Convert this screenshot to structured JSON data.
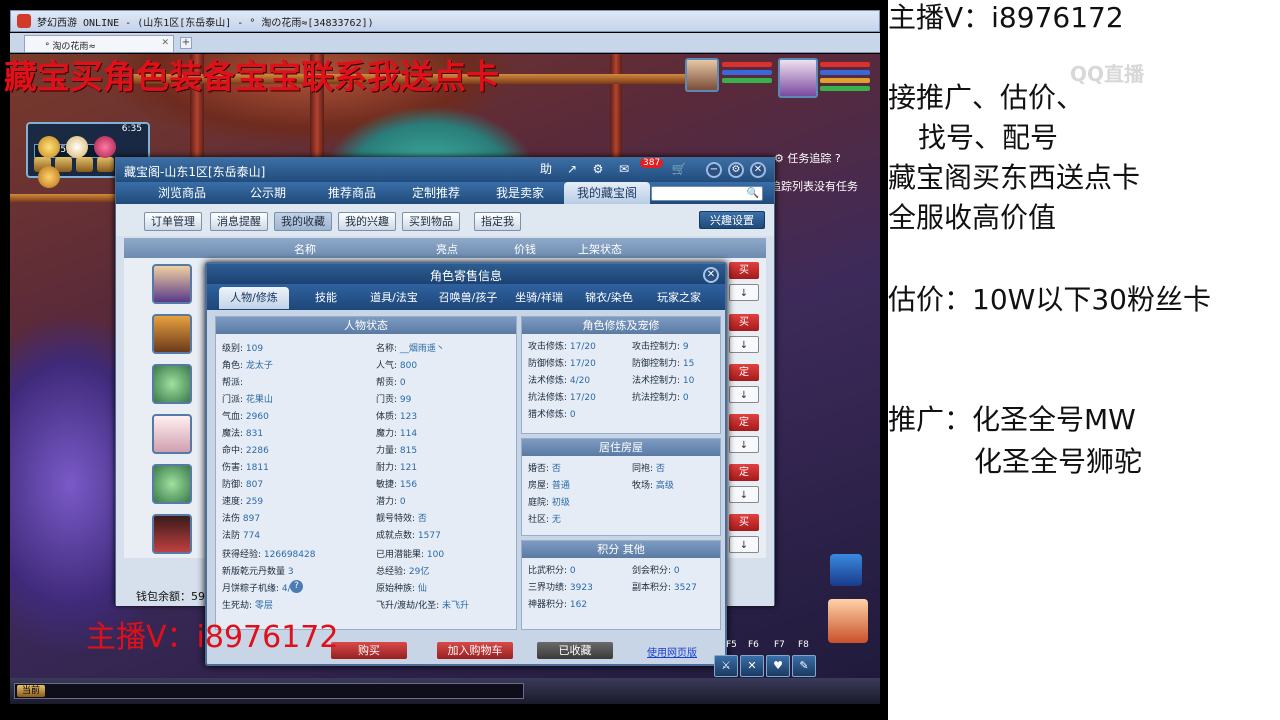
{
  "window": {
    "title": "梦幻西游 ONLINE - (山东1区[东岳泰山] - ° 淘の花雨≈[34833762])",
    "tab_label": "° 淘の花雨≈",
    "new_tab": "+"
  },
  "game": {
    "banner_top": "藏宝买角色装备宝宝联系我送点卡",
    "banner_bottom": "主播V：i8976172",
    "clock": "6:35",
    "coords": "[35, 13]",
    "task_tracking": "任务追踪",
    "task_empty": "追踪列表没有任务",
    "chat_channel": "当前",
    "fkeys": [
      "F5",
      "F6",
      "F7",
      "F8"
    ]
  },
  "cbg": {
    "title": "藏宝阁-山东1区[东岳泰山]",
    "help": "助",
    "badge": "387",
    "nav": [
      "浏览商品",
      "公示期",
      "推荐商品",
      "定制推荐",
      "我是卖家",
      "我的藏宝阁"
    ],
    "sub": [
      "订单管理",
      "消息提醒",
      "我的收藏",
      "我的兴趣",
      "买到物品",
      "指定我"
    ],
    "interest_settings": "兴趣设置",
    "columns": [
      "名称",
      "亮点",
      "价钱",
      "上架状态"
    ],
    "row_buttons": [
      "买",
      "↓",
      "买",
      "↓",
      "定",
      "↓",
      "定",
      "↓",
      "定",
      "↓",
      "买",
      "↓"
    ],
    "wallet": "钱包余额：59"
  },
  "role": {
    "title": "角色寄售信息",
    "tabs": [
      "人物/修炼",
      "技能",
      "道具/法宝",
      "召唤兽/孩子",
      "坐骑/祥瑞",
      "锦衣/染色",
      "玩家之家"
    ],
    "status_title": "人物状态",
    "left_col": [
      {
        "k": "级别:",
        "v": "109"
      },
      {
        "k": "角色:",
        "v": "龙太子"
      },
      {
        "k": "帮派:",
        "v": ""
      },
      {
        "k": "门派:",
        "v": "花果山"
      },
      {
        "k": "气血:",
        "v": "2960"
      },
      {
        "k": "魔法:",
        "v": "831"
      },
      {
        "k": "命中:",
        "v": "2286"
      },
      {
        "k": "伤害:",
        "v": "1811"
      },
      {
        "k": "防御:",
        "v": "807"
      },
      {
        "k": "速度:",
        "v": "259"
      },
      {
        "k": "法伤",
        "v": "897"
      },
      {
        "k": "法防",
        "v": "774"
      }
    ],
    "mid_col": [
      {
        "k": "名称:",
        "v": "__烟雨遥丶"
      },
      {
        "k": "人气:",
        "v": "800"
      },
      {
        "k": "帮贡:",
        "v": "0"
      },
      {
        "k": "门贡:",
        "v": "99"
      },
      {
        "k": "体质:",
        "v": "123"
      },
      {
        "k": "魔力:",
        "v": "114"
      },
      {
        "k": "力量:",
        "v": "815"
      },
      {
        "k": "耐力:",
        "v": "121"
      },
      {
        "k": "敏捷:",
        "v": "156"
      },
      {
        "k": "潜力:",
        "v": "0"
      },
      {
        "k": "靓号特效:",
        "v": "否"
      },
      {
        "k": "成就点数:",
        "v": "1577"
      }
    ],
    "extra_left": [
      {
        "k": "获得经验:",
        "v": "126698428"
      },
      {
        "k": "新版乾元丹数量",
        "v": "3"
      },
      {
        "k": "月饼粽子机缘:",
        "v": "4/60"
      },
      {
        "k": "生死劫:",
        "v": "零层"
      }
    ],
    "extra_mid": [
      {
        "k": "已用潜能果:",
        "v": "100"
      },
      {
        "k": "总经验:",
        "v": "29亿"
      },
      {
        "k": "原始种族:",
        "v": "仙"
      },
      {
        "k": "飞升/渡劫/化圣:",
        "v": "未飞升"
      }
    ],
    "cultivation_title": "角色修炼及宠修",
    "cultivation": [
      {
        "k": "攻击修炼:",
        "v": "17/20",
        "k2": "攻击控制力:",
        "v2": "9"
      },
      {
        "k": "防御修炼:",
        "v": "17/20",
        "k2": "防御控制力:",
        "v2": "15"
      },
      {
        "k": "法术修炼:",
        "v": "4/20",
        "k2": "法术控制力:",
        "v2": "10"
      },
      {
        "k": "抗法修炼:",
        "v": "17/20",
        "k2": "抗法控制力:",
        "v2": "0"
      },
      {
        "k": "猎术修炼:",
        "v": "0",
        "k2": "",
        "v2": ""
      }
    ],
    "house_title": "居住房屋",
    "house": [
      {
        "k": "婚否:",
        "v": "否",
        "k2": "同袍:",
        "v2": "否"
      },
      {
        "k": "房屋:",
        "v": "普通",
        "k2": "牧场:",
        "v2": "高级"
      },
      {
        "k": "庭院:",
        "v": "初级",
        "k2": "",
        "v2": ""
      },
      {
        "k": "社区:",
        "v": "无",
        "k2": "",
        "v2": ""
      }
    ],
    "score_title": "积分 其他",
    "score": [
      {
        "k": "比武积分:",
        "v": "0",
        "k2": "剑会积分:",
        "v2": "0"
      },
      {
        "k": "三界功绩:",
        "v": "3923",
        "k2": "副本积分:",
        "v2": "3527"
      },
      {
        "k": "神器积分:",
        "v": "162",
        "k2": "",
        "v2": ""
      }
    ],
    "buy": "购买",
    "add_cart": "加入购物车",
    "favorited": "已收藏",
    "web_version": "使用网页版"
  },
  "right_panel": {
    "lines": [
      "主播V：i8976172",
      "接推广、估价、",
      "找号、配号",
      "藏宝阁买东西送点卡",
      "全服收高价值",
      "估价：10W以下30粉丝卡",
      "推广：化圣全号MW",
      "化圣全号狮驼"
    ],
    "watermark": "QQ直播"
  },
  "colors": {
    "banner_red": "#e0101a",
    "window_blue": "#214c7d",
    "panel_bg": "#e5ecf5"
  }
}
